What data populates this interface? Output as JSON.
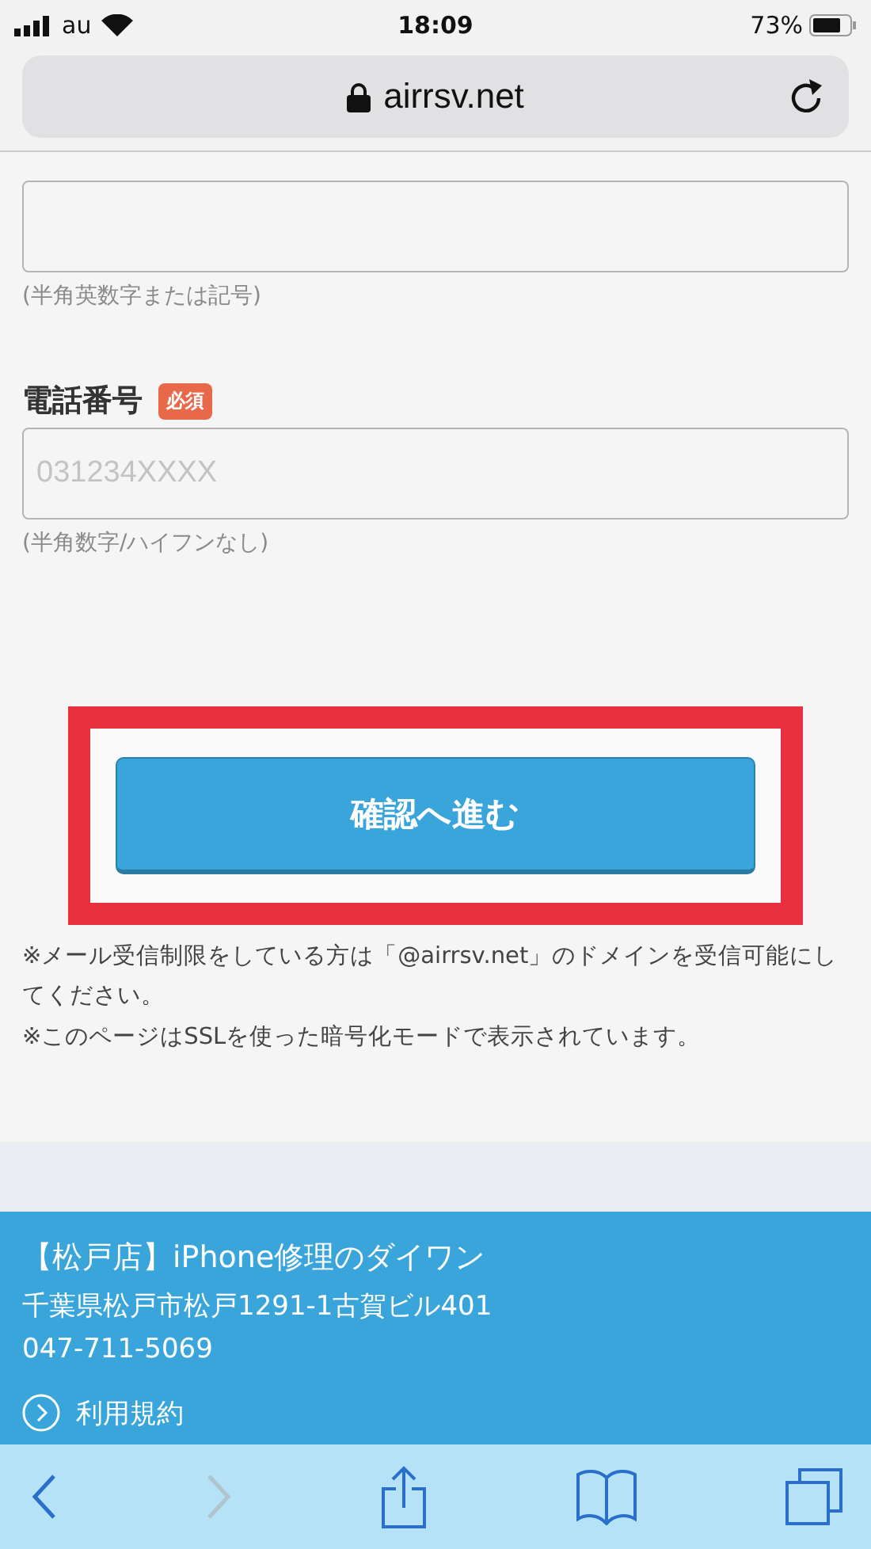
{
  "status_bar": {
    "carrier": "au",
    "time": "18:09",
    "battery": "73%"
  },
  "address_bar": {
    "url": "airrsv.net"
  },
  "form": {
    "fields": [
      {
        "hint": "(半角英数字または記号)"
      },
      {
        "label": "電話番号",
        "required_badge": "必須",
        "placeholder": "031234XXXX",
        "hint": "(半角数字/ハイフンなし)"
      }
    ],
    "submit_button": "確認へ進む",
    "highlighted": true,
    "notes": [
      "※メール受信制限をしている方は「@airrsv.net」のドメインを受信可能にしてください。",
      "※このページはSSLを使った暗号化モードで表示されています。"
    ]
  },
  "footer": {
    "shop_name": "【松戸店】iPhone修理のダイワン",
    "address": "千葉県松戸市松戸1291-1古賀ビル401",
    "phone": "047-711-5069",
    "links": [
      "利用規約"
    ]
  },
  "toolbar": {
    "buttons": [
      {
        "kind": "back",
        "disabled": false
      },
      {
        "kind": "forward",
        "disabled": true
      },
      {
        "kind": "share",
        "disabled": false
      },
      {
        "kind": "bookmarks",
        "disabled": false
      },
      {
        "kind": "tabs",
        "disabled": false
      }
    ]
  }
}
